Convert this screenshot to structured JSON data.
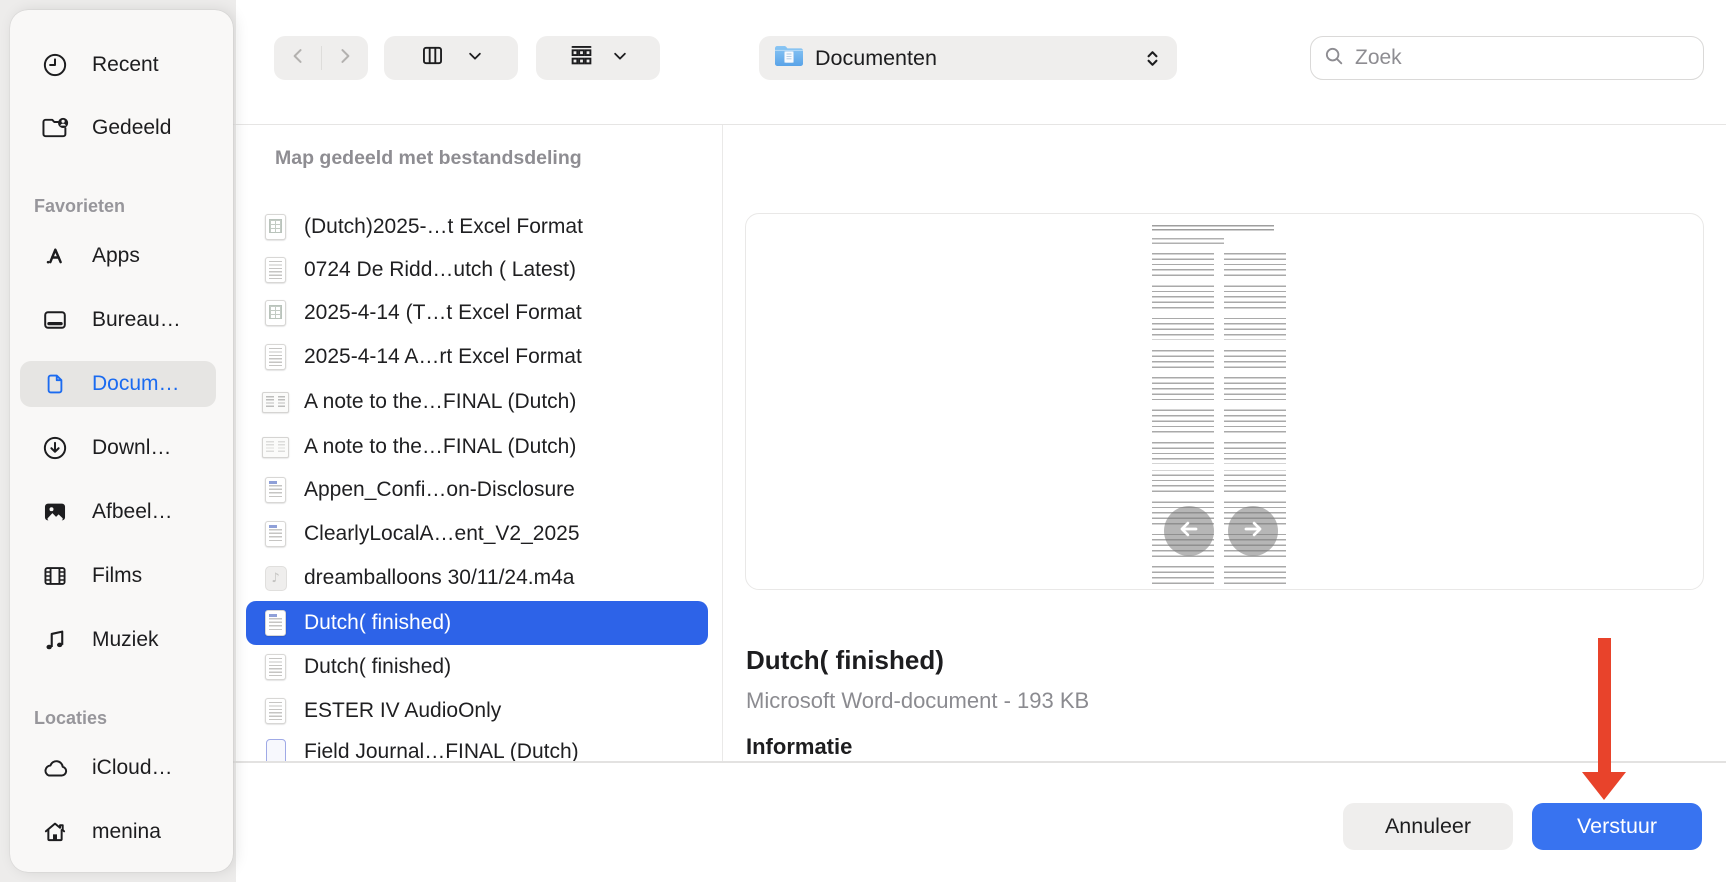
{
  "sidebar": {
    "top_items": [
      {
        "label": "Recent",
        "icon": "clock-icon"
      },
      {
        "label": "Gedeeld",
        "icon": "shared-folder-icon"
      }
    ],
    "sections": [
      {
        "title": "Favorieten",
        "items": [
          {
            "label": "Apps",
            "icon": "app-store-icon"
          },
          {
            "label": "Bureau…",
            "icon": "desktop-icon"
          },
          {
            "label": "Docum…",
            "icon": "document-icon",
            "selected": true
          },
          {
            "label": "Downl…",
            "icon": "download-icon"
          },
          {
            "label": "Afbeel…",
            "icon": "photos-icon"
          },
          {
            "label": "Films",
            "icon": "film-icon"
          },
          {
            "label": "Muziek",
            "icon": "music-note-icon"
          }
        ]
      },
      {
        "title": "Locaties",
        "items": [
          {
            "label": "iCloud…",
            "icon": "cloud-icon"
          },
          {
            "label": "menina",
            "icon": "home-icon"
          }
        ]
      }
    ]
  },
  "toolbar": {
    "back_icon": "chevron-left-icon",
    "forward_icon": "chevron-right-icon",
    "view_icon": "column-view-icon",
    "group_icon": "group-view-icon",
    "location": {
      "label": "Documenten",
      "icon": "blue-folder-icon"
    },
    "search_placeholder": "Zoek"
  },
  "list": {
    "header": "Map gedeeld met bestandsdeling",
    "files": [
      {
        "name": "(Dutch)2025-…t Excel Format",
        "icon": "table-document"
      },
      {
        "name": "0724 De Ridd…utch ( Latest)",
        "icon": "text-document"
      },
      {
        "name": "2025-4-14 (T…t Excel Format",
        "icon": "table-document"
      },
      {
        "name": "2025-4-14 A…rt Excel Format",
        "icon": "text-document"
      },
      {
        "name": "A note to the…FINAL (Dutch)",
        "icon": "two-page-document"
      },
      {
        "name": "A note to the…FINAL (Dutch)",
        "icon": "two-page-document"
      },
      {
        "name": "Appen_Confi…on-Disclosure",
        "icon": "word-document"
      },
      {
        "name": "ClearlyLocalA…ent_V2_2025",
        "icon": "word-document"
      },
      {
        "name": "dreamballoons 30/11/24.m4a",
        "icon": "audio-file"
      },
      {
        "name": "Dutch( finished)",
        "icon": "word-document",
        "selected": true
      },
      {
        "name": "Dutch( finished)",
        "icon": "text-document"
      },
      {
        "name": "ESTER IV AudioOnly",
        "icon": "text-document"
      },
      {
        "name": "Field Journal…FINAL (Dutch)",
        "icon": "empty-document"
      }
    ]
  },
  "preview": {
    "file_title": "Dutch( finished)",
    "file_meta": "Microsoft Word-document - 193 KB",
    "info_heading": "Informatie",
    "back_icon": "arrow-left-icon",
    "forward_icon": "arrow-right-icon"
  },
  "actions": {
    "cancel": "Annuleer",
    "submit": "Verstuur"
  },
  "colors": {
    "selection_blue": "#2D63E8",
    "button_blue": "#3873F0",
    "link_blue": "#1B6BF0",
    "annotation_red": "#E8432B"
  }
}
